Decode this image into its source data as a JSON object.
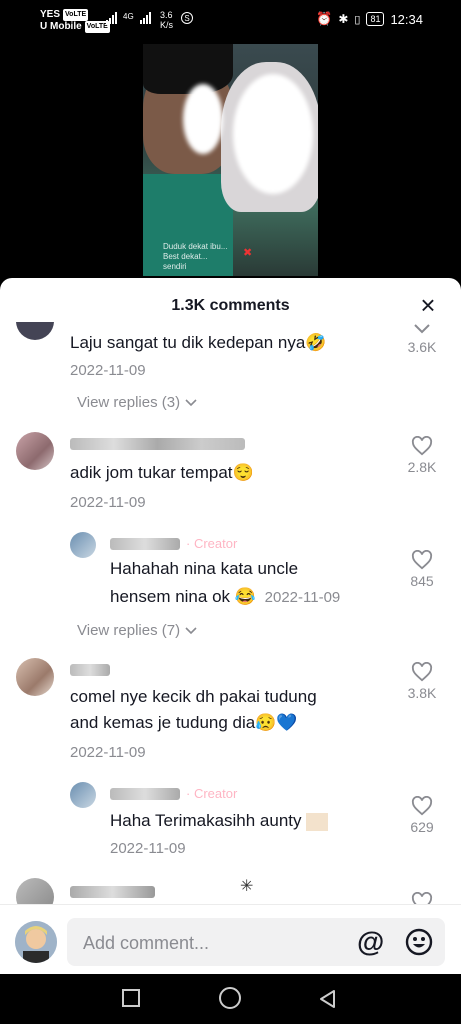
{
  "status": {
    "carrier1": "YES",
    "carrier2": "U Mobile",
    "volte": "VoLTE",
    "net": "4G",
    "speed_value": "3.6",
    "speed_unit": "K/s",
    "s_badge": "S",
    "battery": "81",
    "time": "12:34"
  },
  "video": {
    "caption_line1": "Duduk dekat ibu...",
    "caption_line2": "Best dekat...",
    "caption_line3": "sendiri"
  },
  "sheet": {
    "title": "1.3K comments",
    "close_label": "×"
  },
  "comments": [
    {
      "text": "Laju sangat tu dik kedepan nya🤣",
      "date": "2022-11-09",
      "likes": "3.6K",
      "view_replies": "View replies (3)"
    },
    {
      "text": "adik jom tukar tempat😌",
      "date": "2022-11-09",
      "likes": "2.8K"
    },
    {
      "creator_tag": "· Creator",
      "text_line1": "Hahahah nina kata uncle",
      "text_line2": "hensem nina ok 😂",
      "date": "2022-11-09",
      "likes": "845",
      "view_replies": "View replies (7)"
    },
    {
      "text_line1": "comel nye kecik dh pakai tudung",
      "text_line2": "and kemas je tudung dia😥💙",
      "date": "2022-11-09",
      "likes": "3.8K"
    },
    {
      "creator_tag": "· Creator",
      "text": "Haha Terimakasihh aunty ",
      "date": "2022-11-09",
      "likes": "629"
    }
  ],
  "input": {
    "placeholder": "Add comment...",
    "at_label": "@"
  },
  "colors": {
    "accent": "#fe2c55",
    "text": "#161823",
    "muted": "#8a8b91"
  }
}
